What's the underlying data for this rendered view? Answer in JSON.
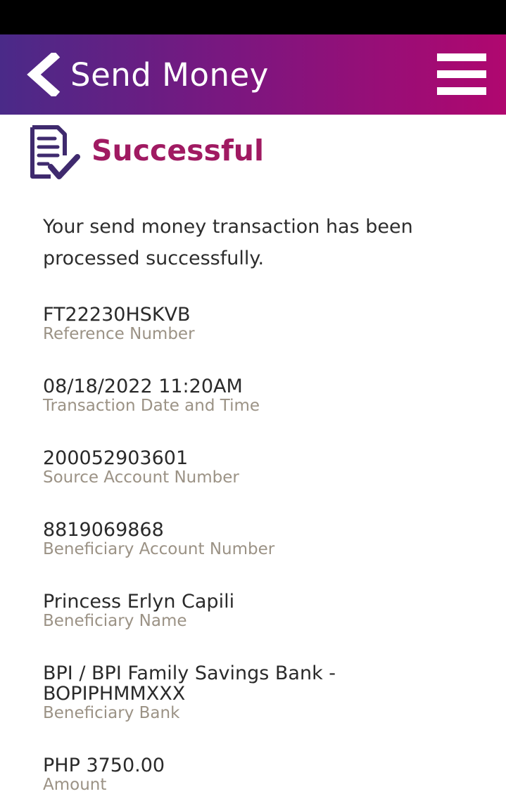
{
  "header": {
    "title": "Send Money",
    "back_icon": "chevron-left-icon",
    "menu_icon": "hamburger-menu-icon",
    "gradient_start": "#4a2a88",
    "gradient_end": "#b0076f"
  },
  "status": {
    "icon": "receipt-check-icon",
    "title": "Successful",
    "title_color": "#a01a62",
    "message": "Your send money transaction has been processed successfully."
  },
  "details": [
    {
      "value": "FT22230HSKVB",
      "label": "Reference Number"
    },
    {
      "value": "08/18/2022 11:20AM",
      "label": "Transaction Date and Time"
    },
    {
      "value": "200052903601",
      "label": "Source Account Number"
    },
    {
      "value": "8819069868",
      "label": "Beneficiary Account Number"
    },
    {
      "value": "Princess Erlyn Capili",
      "label": "Beneficiary Name"
    },
    {
      "value": "BPI / BPI Family Savings Bank - BOPIPHMMXXX",
      "label": "Beneficiary Bank"
    },
    {
      "value": "PHP 3750.00",
      "label": "Amount"
    }
  ]
}
